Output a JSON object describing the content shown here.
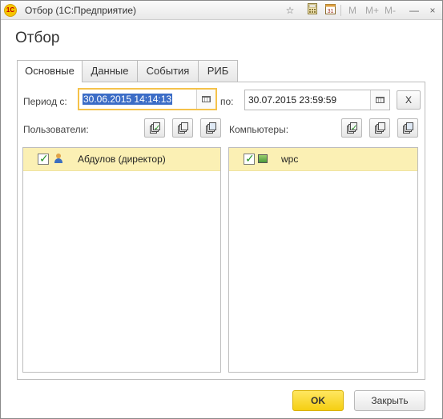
{
  "window": {
    "app_logo": "1С",
    "title": "Отбор  (1С:Предприятие)",
    "toolbar_icons": [
      "star-icon",
      "calculator-icon",
      "calendar-icon"
    ],
    "memory_buttons": [
      "M",
      "M+",
      "M-"
    ],
    "controls": {
      "minimize": "—",
      "maximize": "□",
      "close": "×"
    }
  },
  "form": {
    "title": "Отбор",
    "tabs": [
      {
        "label": "Основные",
        "active": true
      },
      {
        "label": "Данные",
        "active": false
      },
      {
        "label": "События",
        "active": false
      },
      {
        "label": "РИБ",
        "active": false
      }
    ],
    "period": {
      "from_label": "Период с:",
      "from_value": "30.06.2015 14:14:13",
      "to_label": "по:",
      "to_value": "30.07.2015 23:59:59",
      "clear_label": "X"
    },
    "users": {
      "label": "Пользователи:",
      "items": [
        {
          "checked": true,
          "icon": "user-icon",
          "text": "Абдулов (директор)"
        }
      ]
    },
    "computers": {
      "label": "Компьютеры:",
      "items": [
        {
          "checked": true,
          "icon": "computer-icon",
          "text": "wpc"
        }
      ]
    }
  },
  "footer": {
    "ok_label": "OK",
    "close_label": "Закрыть"
  },
  "colors": {
    "accent_yellow": "#f5cf12",
    "selected_row": "#fbf0b4",
    "focus_border": "#f5c24a",
    "selection_blue": "#3b6cc6"
  }
}
